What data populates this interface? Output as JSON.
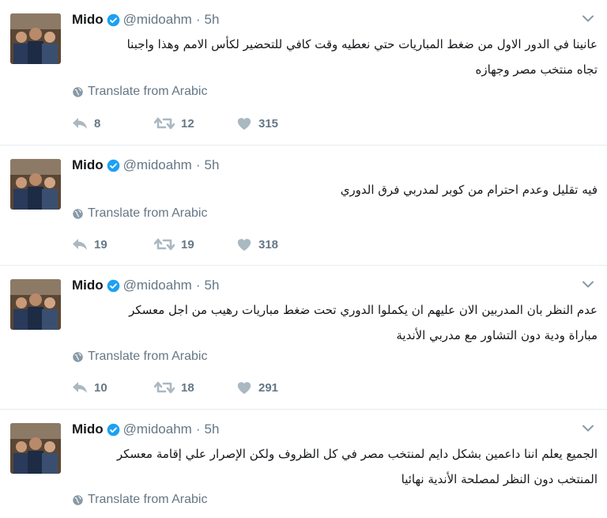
{
  "colors": {
    "text": "#14171a",
    "secondary": "#657786",
    "verified": "#1da1f2",
    "divider": "#e6ecf0"
  },
  "icons": {
    "avatar": "profile-photo",
    "verified": "verified-badge-icon",
    "caret": "chevron-down-icon",
    "globe": "globe-icon",
    "reply": "reply-icon",
    "retweet": "retweet-icon",
    "like": "heart-icon"
  },
  "tweets": [
    {
      "name": "Mido",
      "handle": "@midoahm",
      "dot": "·",
      "time": "5h",
      "text_lines": [
        "عانينا في الدور الاول من ضغط المباريات حتي نعطيه وقت كافي للتحضير لكأس الامم وهذا واجبنا",
        "تجاه منتخب مصر وجهازه"
      ],
      "translate": "Translate from Arabic",
      "replies": "8",
      "retweets": "12",
      "likes": "315"
    },
    {
      "name": "Mido",
      "handle": "@midoahm",
      "dot": "·",
      "time": "5h",
      "text_lines": [
        "فيه تقليل وعدم احترام من كوبر لمدربي فرق الدوري"
      ],
      "translate": "Translate from Arabic",
      "replies": "19",
      "retweets": "19",
      "likes": "318"
    },
    {
      "name": "Mido",
      "handle": "@midoahm",
      "dot": "·",
      "time": "5h",
      "text_lines": [
        "عدم النظر بان المدربين الان عليهم ان يكملوا الدوري تحت ضغط مباريات رهيب من اجل معسكر",
        "مباراة ودية دون التشاور مع مدربي الأندية"
      ],
      "translate": "Translate from Arabic",
      "replies": "10",
      "retweets": "18",
      "likes": "291"
    },
    {
      "name": "Mido",
      "handle": "@midoahm",
      "dot": "·",
      "time": "5h",
      "text_lines": [
        "الجميع يعلم اننا داعمين بشكل دايم لمنتخب مصر في كل الظروف ولكن الإصرار علي إقامة معسكر",
        "المنتخب دون النظر لمصلحة الأندية نهائيا"
      ],
      "translate": "Translate from Arabic"
    }
  ]
}
